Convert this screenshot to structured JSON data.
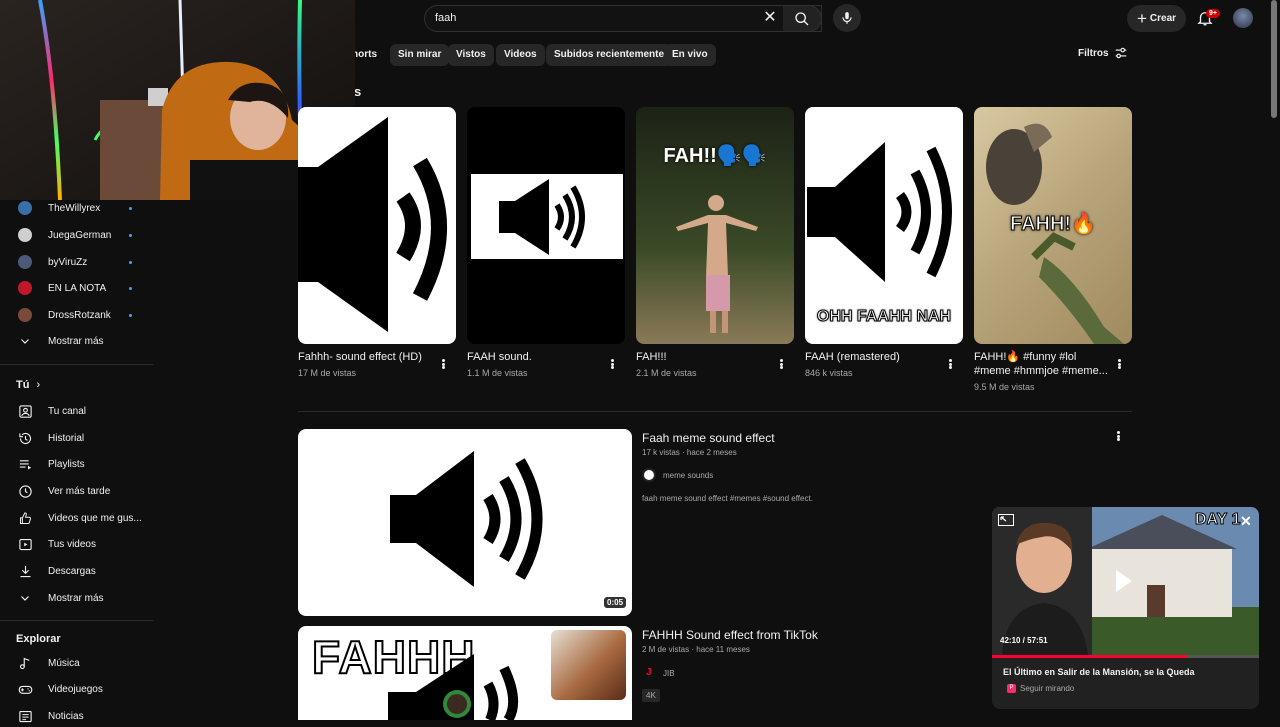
{
  "search": {
    "query": "faah"
  },
  "header": {
    "create_label": "Crear",
    "notifications_badge": "9+"
  },
  "chips": [
    {
      "label": "horts"
    },
    {
      "label": "Sin mirar"
    },
    {
      "label": "Vistos"
    },
    {
      "label": "Videos"
    },
    {
      "label": "Subidos recientemente"
    },
    {
      "label": "En vivo"
    }
  ],
  "filters_label": "Filtros",
  "shorts_section": {
    "heading_fragment": "s"
  },
  "sidebar": {
    "subscriptions": [
      {
        "name": "TheWillyrex",
        "color": "#3a6ea8"
      },
      {
        "name": "JuegaGerman",
        "color": "#cfcfcf"
      },
      {
        "name": "byViruZz",
        "color": "#4a5a78"
      },
      {
        "name": "EN LA NOTA",
        "color": "#c0182a"
      },
      {
        "name": "DrossRotzank",
        "color": "#7a4a38"
      }
    ],
    "show_more": "Mostrar más",
    "you_heading": "Tú",
    "you_items": [
      {
        "label": "Tu canal",
        "icon": "user-square-icon"
      },
      {
        "label": "Historial",
        "icon": "history-icon"
      },
      {
        "label": "Playlists",
        "icon": "playlists-icon"
      },
      {
        "label": "Ver más tarde",
        "icon": "clock-icon"
      },
      {
        "label": "Videos que me gus...",
        "icon": "thumbs-up-icon"
      },
      {
        "label": "Tus videos",
        "icon": "video-icon"
      },
      {
        "label": "Descargas",
        "icon": "download-icon"
      }
    ],
    "show_more_2": "Mostrar más",
    "explore_heading": "Explorar",
    "explore_items": [
      {
        "label": "Música",
        "icon": "music-icon"
      },
      {
        "label": "Videojuegos",
        "icon": "gamepad-icon"
      },
      {
        "label": "Noticias",
        "icon": "news-icon"
      }
    ]
  },
  "shorts": [
    {
      "title": "Fahhh- sound effect (HD)",
      "views": "17 M de vistas"
    },
    {
      "title": "FAAH sound.",
      "views": "1.1 M de vistas"
    },
    {
      "title": "FAH!!!",
      "views": "2.1 M de vistas",
      "overlay": "FAH!!🗣️🗣️"
    },
    {
      "title": "FAAH (remastered)",
      "views": "846 k vistas",
      "overlay": "OHH FAAHH NAH"
    },
    {
      "title": "FAHH!🔥 #funny #lol #meme #hmmjoe #meme...",
      "views": "9.5 M de vistas",
      "overlay": "FAHH!🔥"
    }
  ],
  "videos": [
    {
      "title": "Faah meme sound effect",
      "meta": "17 k vistas · hace 2 meses",
      "channel": "meme sounds",
      "description": "faah meme sound effect #memes #sound effect.",
      "duration": "0:05"
    },
    {
      "title": "FAHHH Sound effect from TikTok",
      "meta": "2 M de vistas · hace 11 meses",
      "channel": "JIB",
      "badge": "4K",
      "thumb_text": "FAHHH"
    }
  ],
  "miniplayer": {
    "time": "42:10 / 57:51",
    "title": "El Último en Salir de la Mansión, se la Queda",
    "subtitle": "Seguir mirando",
    "corner_text": "DAY 1"
  },
  "colors": {
    "accent": "#3ea6ff",
    "brand_red": "#ff0033",
    "background": "#0f0f0f"
  }
}
